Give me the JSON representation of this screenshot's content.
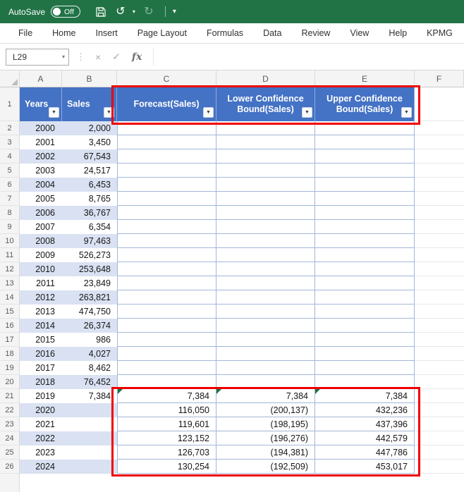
{
  "titlebar": {
    "autosave_label": "AutoSave",
    "autosave_state": "Off",
    "icons": {
      "save": "floppy-disk",
      "undo": "↺",
      "redo": "↻",
      "undo_caret": "▾",
      "qat_more": "▾"
    }
  },
  "menu": {
    "items": [
      "File",
      "Home",
      "Insert",
      "Page Layout",
      "Formulas",
      "Data",
      "Review",
      "View",
      "Help",
      "KPMG"
    ]
  },
  "formula_bar": {
    "name_box": "L29",
    "name_caret": "▾",
    "dots": "⋮",
    "cancel": "×",
    "enter": "✓",
    "fx": "fx",
    "formula_value": ""
  },
  "grid": {
    "column_headers": [
      "A",
      "B",
      "C",
      "D",
      "E",
      "F"
    ],
    "header_row_number": "1",
    "first_data_row": 2,
    "filter_glyph": "▼",
    "table_headers": [
      {
        "col": "A",
        "label": "Years"
      },
      {
        "col": "B",
        "label": "Sales"
      },
      {
        "col": "C",
        "label": "Forecast(Sales)"
      },
      {
        "col": "D",
        "label": "Lower Confidence Bound(Sales)"
      },
      {
        "col": "E",
        "label": "Upper Confidence Bound(Sales)"
      }
    ],
    "rows": [
      {
        "year": "2000",
        "sales": "2,000",
        "forecast": "",
        "lower": "",
        "upper": ""
      },
      {
        "year": "2001",
        "sales": "3,450",
        "forecast": "",
        "lower": "",
        "upper": ""
      },
      {
        "year": "2002",
        "sales": "67,543",
        "forecast": "",
        "lower": "",
        "upper": ""
      },
      {
        "year": "2003",
        "sales": "24,517",
        "forecast": "",
        "lower": "",
        "upper": ""
      },
      {
        "year": "2004",
        "sales": "6,453",
        "forecast": "",
        "lower": "",
        "upper": ""
      },
      {
        "year": "2005",
        "sales": "8,765",
        "forecast": "",
        "lower": "",
        "upper": ""
      },
      {
        "year": "2006",
        "sales": "36,767",
        "forecast": "",
        "lower": "",
        "upper": ""
      },
      {
        "year": "2007",
        "sales": "6,354",
        "forecast": "",
        "lower": "",
        "upper": ""
      },
      {
        "year": "2008",
        "sales": "97,463",
        "forecast": "",
        "lower": "",
        "upper": ""
      },
      {
        "year": "2009",
        "sales": "526,273",
        "forecast": "",
        "lower": "",
        "upper": ""
      },
      {
        "year": "2010",
        "sales": "253,648",
        "forecast": "",
        "lower": "",
        "upper": ""
      },
      {
        "year": "2011",
        "sales": "23,849",
        "forecast": "",
        "lower": "",
        "upper": ""
      },
      {
        "year": "2012",
        "sales": "263,821",
        "forecast": "",
        "lower": "",
        "upper": ""
      },
      {
        "year": "2013",
        "sales": "474,750",
        "forecast": "",
        "lower": "",
        "upper": ""
      },
      {
        "year": "2014",
        "sales": "26,374",
        "forecast": "",
        "lower": "",
        "upper": ""
      },
      {
        "year": "2015",
        "sales": "986",
        "forecast": "",
        "lower": "",
        "upper": ""
      },
      {
        "year": "2016",
        "sales": "4,027",
        "forecast": "",
        "lower": "",
        "upper": ""
      },
      {
        "year": "2017",
        "sales": "8,462",
        "forecast": "",
        "lower": "",
        "upper": ""
      },
      {
        "year": "2018",
        "sales": "76,452",
        "forecast": "",
        "lower": "",
        "upper": ""
      },
      {
        "year": "2019",
        "sales": "7,384",
        "forecast": "7,384",
        "lower": "7,384",
        "upper": "7,384",
        "triangles": true
      },
      {
        "year": "2020",
        "sales": "",
        "forecast": "116,050",
        "lower": "(200,137)",
        "upper": "432,236"
      },
      {
        "year": "2021",
        "sales": "",
        "forecast": "119,601",
        "lower": "(198,195)",
        "upper": "437,396"
      },
      {
        "year": "2022",
        "sales": "",
        "forecast": "123,152",
        "lower": "(196,276)",
        "upper": "442,579"
      },
      {
        "year": "2023",
        "sales": "",
        "forecast": "126,703",
        "lower": "(194,381)",
        "upper": "447,786"
      },
      {
        "year": "2024",
        "sales": "",
        "forecast": "130,254",
        "lower": "(192,509)",
        "upper": "453,017"
      }
    ]
  },
  "annotations": {
    "highlight_color": "#EE0000",
    "boxes": [
      {
        "name": "new-column-headers",
        "range": "C1:E1"
      },
      {
        "name": "forecast-values",
        "range": "C21:E26"
      }
    ]
  },
  "colors": {
    "titlebar_green": "#217346",
    "table_header_blue": "#4472C4",
    "band_blue": "#D9E1F2",
    "cell_border_blue": "#A3B7D9"
  }
}
